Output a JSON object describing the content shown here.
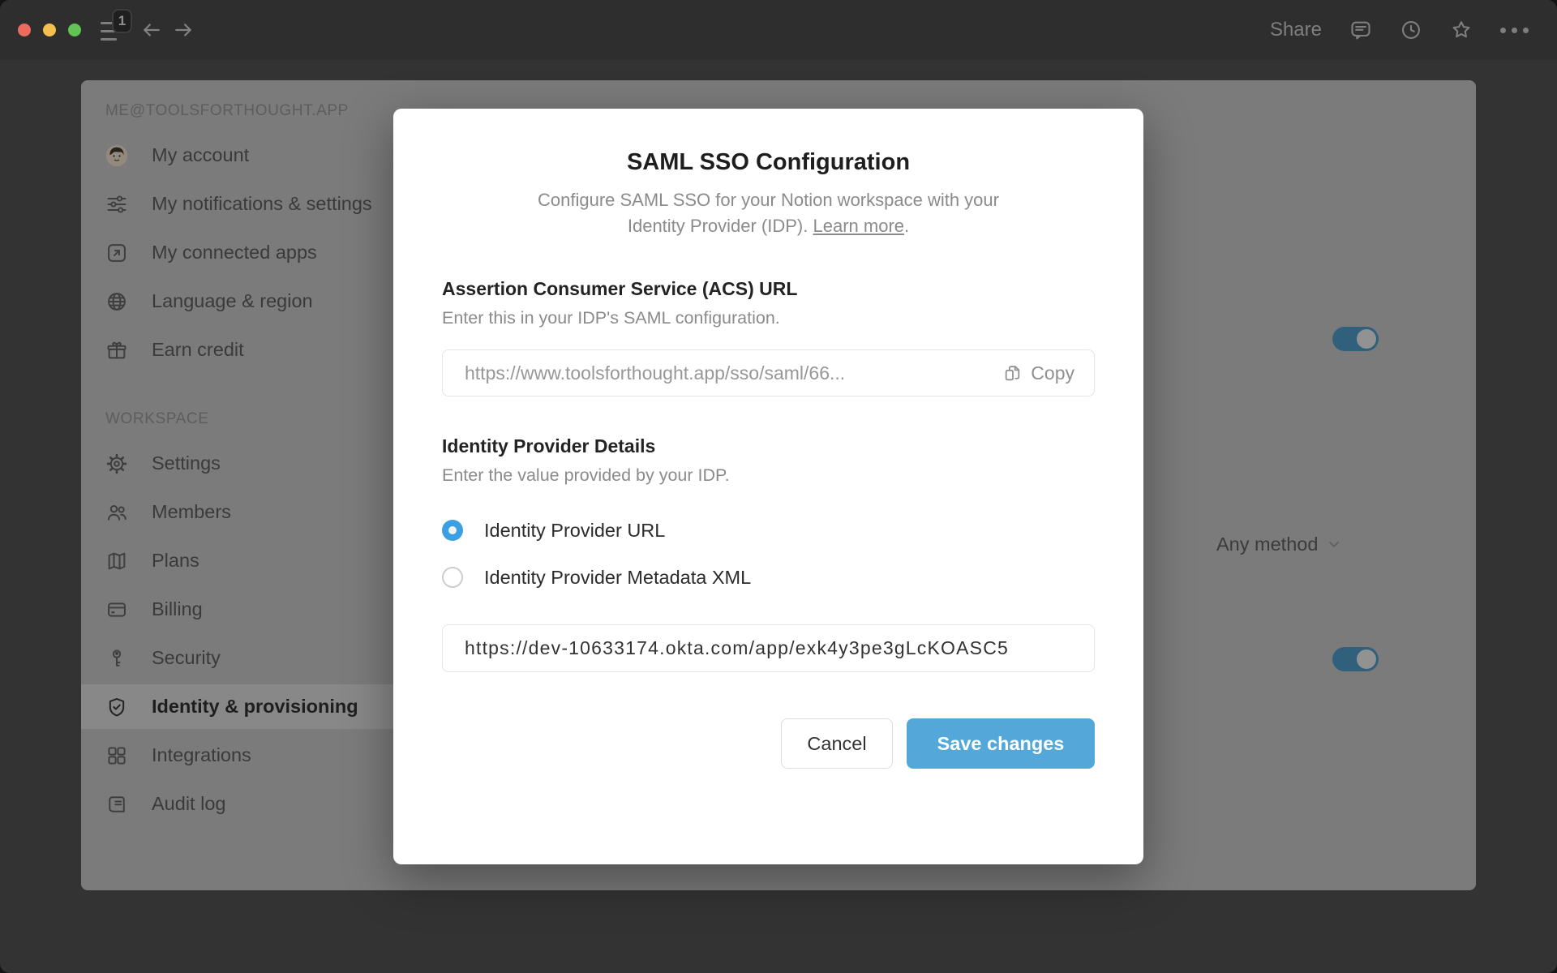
{
  "window": {
    "topbar": {
      "tab_count_badge": "1",
      "share_label": "Share",
      "icons": [
        "menu-icon",
        "back-arrow-icon",
        "forward-arrow-icon",
        "comments-icon",
        "history-clock-icon",
        "star-icon",
        "more-ellipsis-icon"
      ]
    }
  },
  "sidebar": {
    "account_section_header": "ME@TOOLSFORTHOUGHT.APP",
    "account_items": [
      {
        "label": "My account",
        "icon": "avatar"
      },
      {
        "label": "My notifications & settings",
        "icon": "sliders-icon"
      },
      {
        "label": "My connected apps",
        "icon": "arrow-up-right-square-icon"
      },
      {
        "label": "Language & region",
        "icon": "globe-icon"
      },
      {
        "label": "Earn credit",
        "icon": "gift-icon"
      }
    ],
    "workspace_section_header": "WORKSPACE",
    "workspace_items": [
      {
        "label": "Settings",
        "icon": "gear-icon"
      },
      {
        "label": "Members",
        "icon": "members-icon"
      },
      {
        "label": "Plans",
        "icon": "map-icon"
      },
      {
        "label": "Billing",
        "icon": "credit-card-icon"
      },
      {
        "label": "Security",
        "icon": "key-icon"
      },
      {
        "label": "Identity & provisioning",
        "icon": "shield-check-icon",
        "selected": true
      },
      {
        "label": "Integrations",
        "icon": "grid-icon"
      },
      {
        "label": "Audit log",
        "icon": "audit-log-icon"
      }
    ]
  },
  "content": {
    "dropdown_value": "Any method",
    "dropdown_icon": "chevron-down-icon",
    "toggles": [
      {
        "state": "on"
      },
      {
        "state": "on"
      }
    ]
  },
  "modal": {
    "title": "SAML SSO Configuration",
    "description": "Configure SAML SSO for your Notion workspace with your Identity Provider (IDP).",
    "learn_more_label": "Learn more",
    "description_period": ".",
    "acs": {
      "heading": "Assertion Consumer Service (ACS) URL",
      "subheading": "Enter this in your IDP's SAML configuration.",
      "value": "https://www.toolsforthought.app/sso/saml/66...",
      "copy_label": "Copy",
      "copy_icon": "copy-icon"
    },
    "idp": {
      "heading": "Identity Provider Details",
      "subheading": "Enter the value provided by your IDP.",
      "radio_url_label": "Identity Provider URL",
      "radio_xml_label": "Identity Provider Metadata XML",
      "url_value": "https://dev-10633174.okta.com/app/exk4y3pe3gLcKOASC5"
    },
    "cancel_label": "Cancel",
    "save_label": "Save changes"
  },
  "colors": {
    "save_button": "#54a8d9",
    "radio_selected": "#3aa0e1",
    "toggle_on_dimmed": "#31607c",
    "traffic_red": "#ed6a5f",
    "traffic_yellow": "#f5bf4f",
    "traffic_green": "#61c454"
  }
}
